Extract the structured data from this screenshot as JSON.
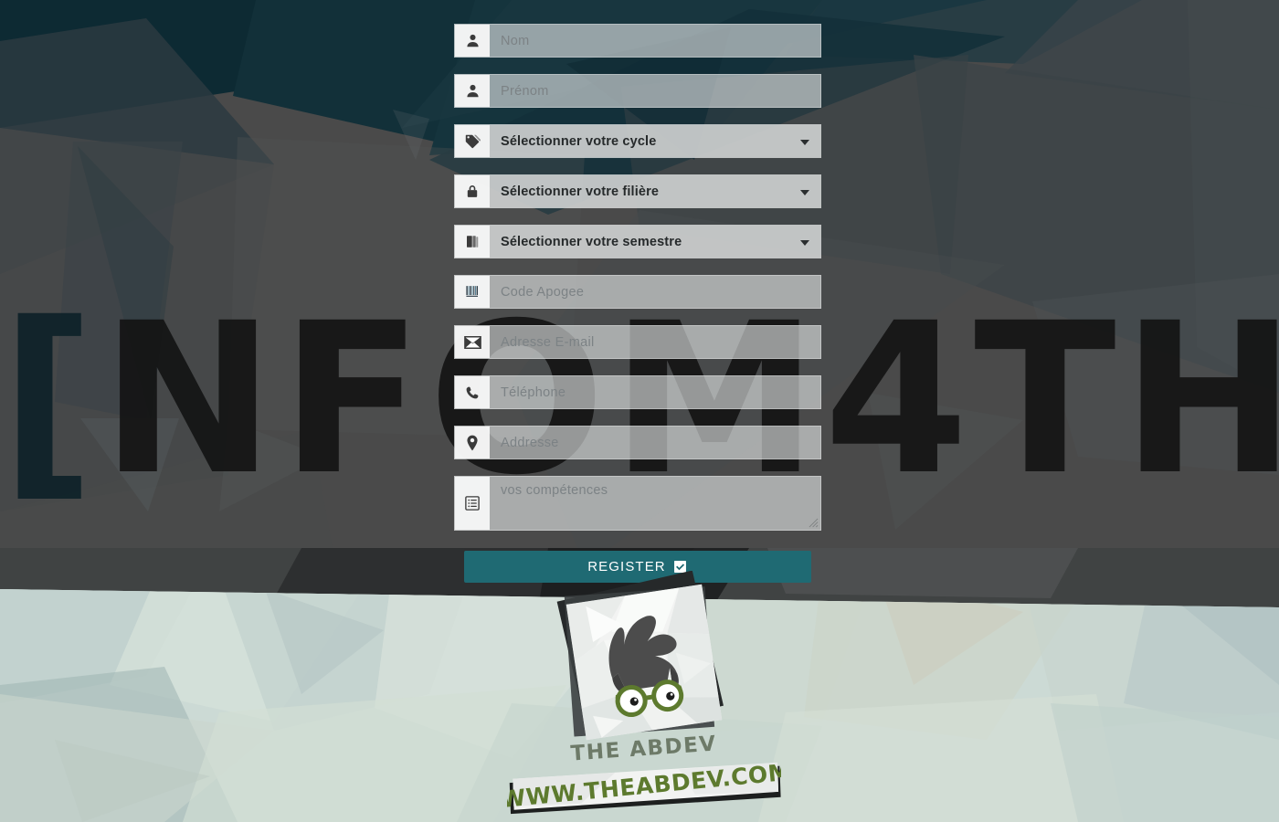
{
  "background": {
    "watermark_left_bracket": "[",
    "watermark_text": "NFOM4TH",
    "watermark_right_bracket": "]",
    "dark_color": "#4a4a4a",
    "accent_polygon_color": "#12303a",
    "light_band_color": "#cfdcd6"
  },
  "form": {
    "fields": [
      {
        "name": "nom",
        "type": "text",
        "icon": "user-icon",
        "placeholder": "Nom"
      },
      {
        "name": "prenom",
        "type": "text",
        "icon": "user-icon",
        "placeholder": "Prénom"
      },
      {
        "name": "cycle",
        "type": "select",
        "icon": "tag-icon",
        "placeholder": "Sélectionner votre cycle"
      },
      {
        "name": "filiere",
        "type": "select",
        "icon": "lock-icon",
        "placeholder": "Sélectionner votre filière"
      },
      {
        "name": "semestre",
        "type": "select",
        "icon": "book-icon",
        "placeholder": "Sélectionner votre semestre"
      },
      {
        "name": "code-apogee",
        "type": "text",
        "icon": "barcode-icon",
        "placeholder": "Code Apogee"
      },
      {
        "name": "email",
        "type": "email",
        "icon": "envelope-icon",
        "placeholder": "Adresse E-mail"
      },
      {
        "name": "telephone",
        "type": "tel",
        "icon": "phone-icon",
        "placeholder": "Téléphone"
      },
      {
        "name": "adresse",
        "type": "text",
        "icon": "map-pin-icon",
        "placeholder": "Addresse"
      },
      {
        "name": "competences",
        "type": "textarea",
        "icon": "list-icon",
        "placeholder": "vos compétences"
      }
    ],
    "submit": {
      "label": "REGISTER",
      "icon": "check-square-icon",
      "color": "#1f6a73"
    }
  },
  "logo": {
    "brand": "THE ABDEV",
    "url": "WWW.THEABDEV.COM",
    "hair_color": "#4c4c4c",
    "glasses_color": "#5d7a2e",
    "card_color": "#f2f3f2"
  }
}
